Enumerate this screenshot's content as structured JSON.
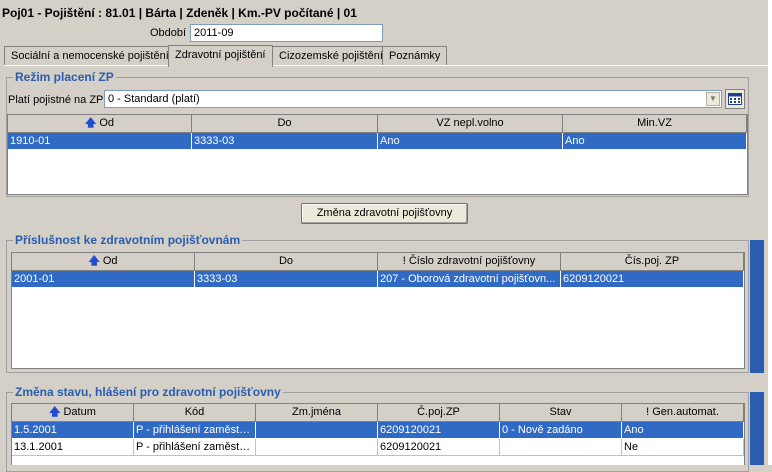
{
  "header": {
    "title": "Poj01 - Pojištění : 81.01 | Bárta | Zdeněk | Km.-PV počítané | 01",
    "period_label": "Období",
    "period_value": "2011-09"
  },
  "tabs": [
    {
      "label": "Sociální a nemocenské pojištění"
    },
    {
      "label": "Zdravotní pojištění"
    },
    {
      "label": "Cizozemské pojištění"
    },
    {
      "label": "Poznámky"
    }
  ],
  "rezim": {
    "title": "Režim placení ZP",
    "combo_label": "Platí pojistné na ZP:",
    "combo_value": "0 - Standard (platí)",
    "columns": [
      "Od",
      "Do",
      "VZ nepl.volno",
      "Min.VZ"
    ],
    "rows": [
      [
        "1910-01",
        "3333-03",
        "Ano",
        "Ano"
      ]
    ],
    "change_button": "Změna zdravotní pojišťovny"
  },
  "prislusnost": {
    "title": "Příslušnost ke zdravotním pojišťovnám",
    "columns": [
      "Od",
      "Do",
      "! Číslo zdravotní pojišťovny",
      "Čís.poj. ZP"
    ],
    "rows": [
      [
        "2001-01",
        "3333-03",
        "207 - Oborová zdravotní pojišťovn...",
        "6209120021"
      ]
    ]
  },
  "zmena": {
    "title": "Změna stavu, hlášení pro zdravotní pojišťovny",
    "columns": [
      "Datum",
      "Kód",
      "Zm.jména",
      "Č.poj.ZP",
      "Stav",
      "! Gen.automat."
    ],
    "rows": [
      [
        "1.5.2001",
        "P - přihlášení zaměstn...",
        "",
        "6209120021",
        "0 - Nově zadáno",
        "Ano"
      ],
      [
        "13.1.2001",
        "P - přihlášení zaměstn...",
        "",
        "6209120021",
        "",
        "Ne"
      ]
    ]
  },
  "colors": {
    "accent": "#316ac5",
    "group_title": "#2a5db0"
  }
}
